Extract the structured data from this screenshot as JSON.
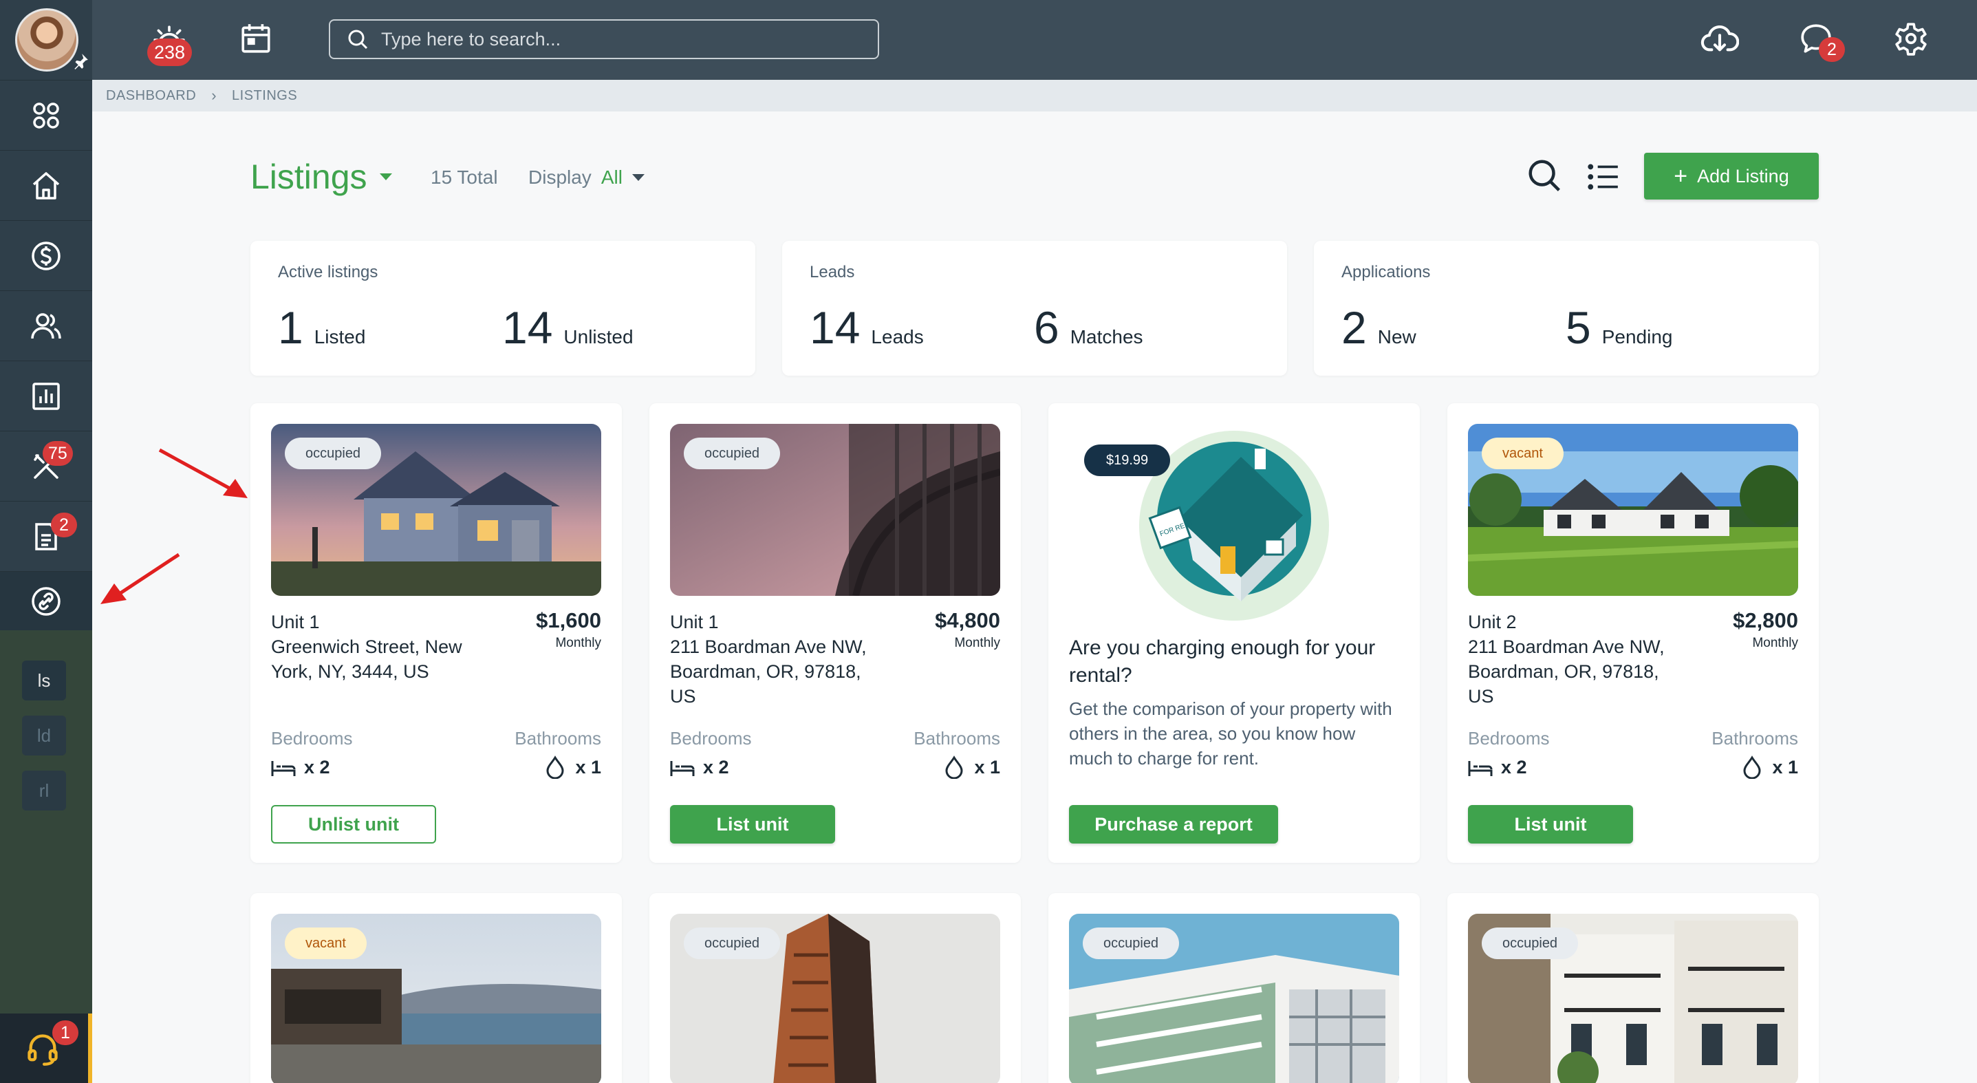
{
  "topbar": {
    "alert_count": "238",
    "search_placeholder": "Type here to search...",
    "message_count": "2"
  },
  "sidebar": {
    "maintenance_count": "75",
    "applications_count": "2",
    "chips": [
      "ls",
      "ld",
      "rl"
    ],
    "support_count": "1"
  },
  "breadcrumb": {
    "items": [
      "DASHBOARD",
      "LISTINGS"
    ]
  },
  "page": {
    "title": "Listings",
    "total": "15 Total",
    "display_label": "Display",
    "display_value": "All",
    "add_label": "Add Listing"
  },
  "stats": [
    {
      "label": "Active listings",
      "a_num": "1",
      "a_txt": "Listed",
      "b_num": "14",
      "b_txt": "Unlisted"
    },
    {
      "label": "Leads",
      "a_num": "14",
      "a_txt": "Leads",
      "b_num": "6",
      "b_txt": "Matches"
    },
    {
      "label": "Applications",
      "a_num": "2",
      "a_txt": "New",
      "b_num": "5",
      "b_txt": "Pending"
    }
  ],
  "labels": {
    "bedrooms": "Bedrooms",
    "bathrooms": "Bathrooms",
    "monthly": "Monthly"
  },
  "listings": [
    {
      "status": "occupied",
      "unit": "Unit 1",
      "address": "Greenwich Street, New York, NY, 3444, US",
      "price": "$1,600",
      "beds": "x 2",
      "baths": "x 1",
      "action": "Unlist unit"
    },
    {
      "status": "occupied",
      "unit": "Unit 1",
      "address": "211 Boardman Ave NW, Boardman, OR, 97818, US",
      "price": "$4,800",
      "beds": "x 2",
      "baths": "x 1",
      "action": "List unit"
    },
    {
      "status": "vacant",
      "unit": "Unit 2",
      "address": "211 Boardman Ave NW, Boardman, OR, 97818, US",
      "price": "$2,800",
      "beds": "x 2",
      "baths": "x 1",
      "action": "List unit"
    }
  ],
  "promo": {
    "price": "$19.99",
    "headline": "Are you charging enough for your rental?",
    "description": "Get the comparison of your property with others in the area, so you know how much to charge for rent.",
    "action": "Purchase a report",
    "sign_text": "FOR RENT"
  },
  "second_row": [
    {
      "status": "vacant"
    },
    {
      "status": "occupied"
    },
    {
      "status": "occupied"
    },
    {
      "status": "occupied"
    }
  ],
  "colors": {
    "accent": "#3fa34d",
    "topbar": "#3d4d59",
    "sidebar": "#2f3f4a",
    "badge": "#d63b3b",
    "annotation_arrow": "#e02020"
  }
}
